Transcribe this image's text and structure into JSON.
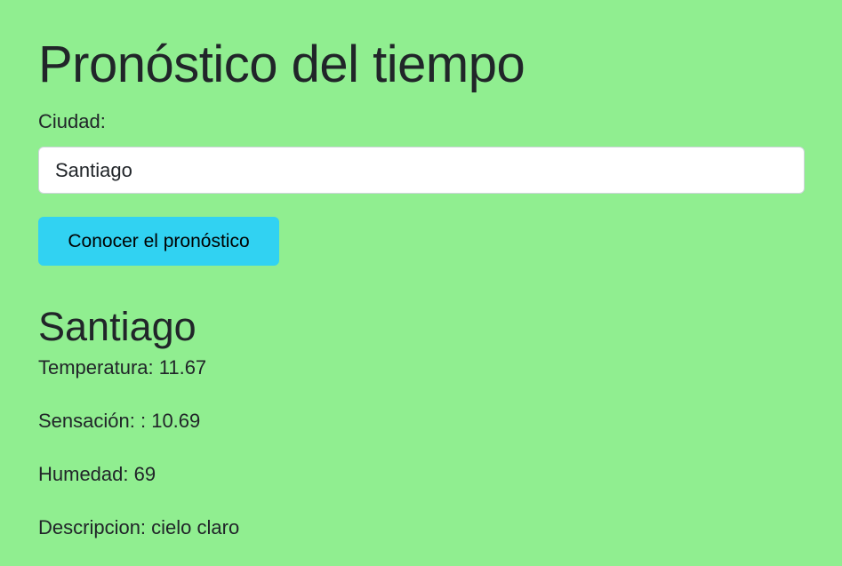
{
  "page": {
    "title": "Pronóstico del tiempo",
    "background": "#90ee90",
    "accent": "#31d2f2"
  },
  "form": {
    "city_label": "Ciudad:",
    "city_value": "Santiago",
    "submit_label": "Conocer el pronóstico"
  },
  "result": {
    "city": "Santiago",
    "temperature_label": "Temperatura:",
    "temperature": "11.67",
    "feels_like_label": "Sensación: :",
    "feels_like": "10.69",
    "humidity_label": "Humedad:",
    "humidity": "69",
    "description_label": "Descripcion:",
    "description": "cielo claro"
  }
}
